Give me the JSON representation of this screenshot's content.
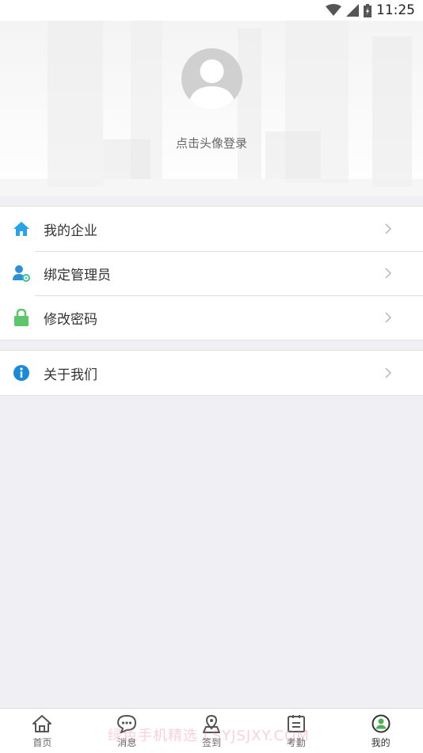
{
  "status_bar": {
    "time": "11:25"
  },
  "profile": {
    "login_hint": "点击头像登录"
  },
  "menu_group_1": [
    {
      "label": "我的企业",
      "icon": "home-icon",
      "color": "#29a3e8"
    },
    {
      "label": "绑定管理员",
      "icon": "user-settings-icon",
      "color": "#2f8fd6"
    },
    {
      "label": "修改密码",
      "icon": "lock-icon",
      "color": "#5cc66a"
    }
  ],
  "menu_group_2": [
    {
      "label": "关于我们",
      "icon": "info-icon",
      "color": "#1a8ad6"
    }
  ],
  "tabbar": {
    "tabs": [
      {
        "label": "首页",
        "icon": "home-outline-icon"
      },
      {
        "label": "消息",
        "icon": "chat-bubble-icon"
      },
      {
        "label": "签到",
        "icon": "location-pin-icon"
      },
      {
        "label": "考勤",
        "icon": "clipboard-icon"
      },
      {
        "label": "我的",
        "icon": "profile-circle-icon"
      }
    ],
    "active_index": 4
  },
  "watermark": "绿色手机精选 LSYJSJXY.COM"
}
